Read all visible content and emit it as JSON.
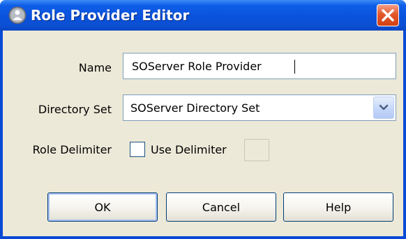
{
  "window": {
    "title": "Role Provider Editor",
    "app_icon": "role-provider-icon",
    "close_icon": "close-icon"
  },
  "form": {
    "name_label": "Name",
    "name_value": "SOServer Role Provider",
    "directory_set_label": "Directory Set",
    "directory_set_value": "SOServer Directory Set",
    "role_delimiter_label": "Role Delimiter",
    "use_delimiter_label": "Use Delimiter",
    "use_delimiter_checked": false,
    "delimiter_value": ""
  },
  "buttons": {
    "ok": "OK",
    "cancel": "Cancel",
    "help": "Help"
  },
  "colors": {
    "titlebar": "#0a52dc",
    "client_background": "#ece9d8",
    "close_button": "#e4572b"
  }
}
